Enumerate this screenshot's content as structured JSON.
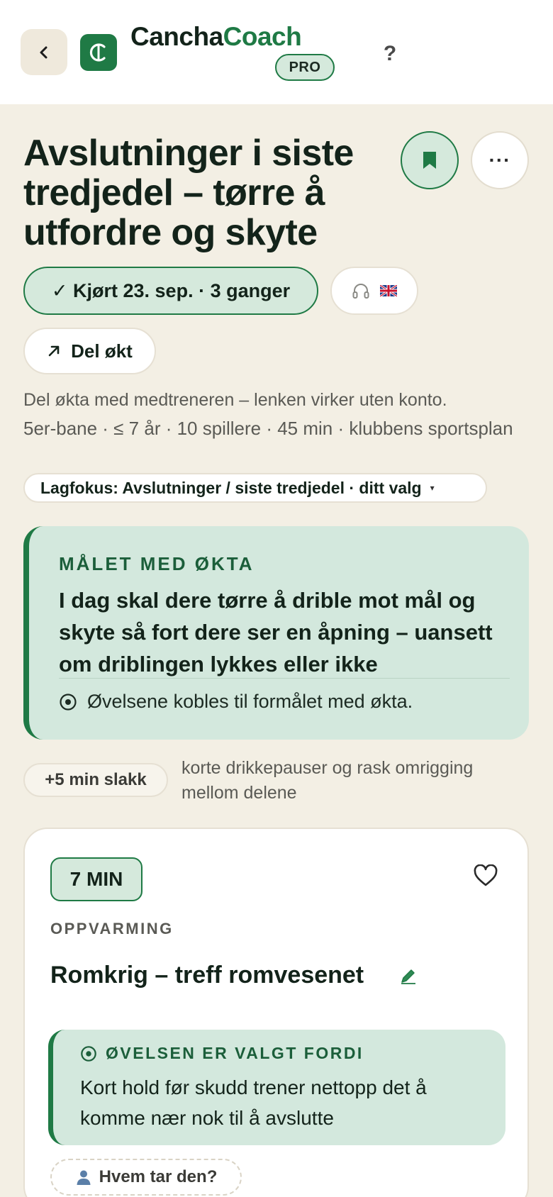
{
  "header": {
    "back_label": "‹",
    "brand_part1": "Cancha",
    "brand_part2": "Coach",
    "pro_label": "PRO",
    "help_label": "?",
    "logo_icon": "cancha-logo-icon"
  },
  "session": {
    "title": "Avslutninger i siste tredjedel – tørre å utfordre og skyte",
    "more_label": "···",
    "done_label": "✓ Kjørt 23. sep. · 3 ganger",
    "share_label": "Del økt",
    "share_hint": "Del økta med medtreneren – lenken virker uten konto.",
    "meta": "5er-bane · ≤ 7 år · 10 spillere · 45 min · klubbens sportsplan",
    "focus_label": "Lagfokus: Avslutninger / siste tredjedel · ditt valg",
    "focus_caret": "▾",
    "icons": [
      "back-icon",
      "bookmark-icon",
      "more-icon",
      "headphones-icon",
      "uk-flag-icon",
      "share-arrow-icon"
    ]
  },
  "goal": {
    "label": "MÅLET MED ØKTA",
    "text": "I dag skal dere tørre å drible mot mål og skyte så fort dere ser en åpning – uansett om driblingen lykkes eller ikke",
    "note": "Øvelsene kobles til formålet med økta."
  },
  "slack": {
    "label": "+5 min slakk",
    "text": "korte drikkepauser og rask omrigging mellom delene"
  },
  "exercise": {
    "time": "7 MIN",
    "phase": "OPPVARMING",
    "name": "Romkrig – treff romvesenet",
    "reason_label": "ØVELSEN ER VALGT FORDI",
    "reason_text": "Kort hold før skudd trener nettopp det å komme nær nok til å avslutte",
    "who_label": "Hvem tar den?"
  },
  "colors": {
    "accent": "#1f7a45",
    "accent_soft": "#d5e9dc",
    "background": "#f3efe4",
    "text": "#13231a"
  }
}
